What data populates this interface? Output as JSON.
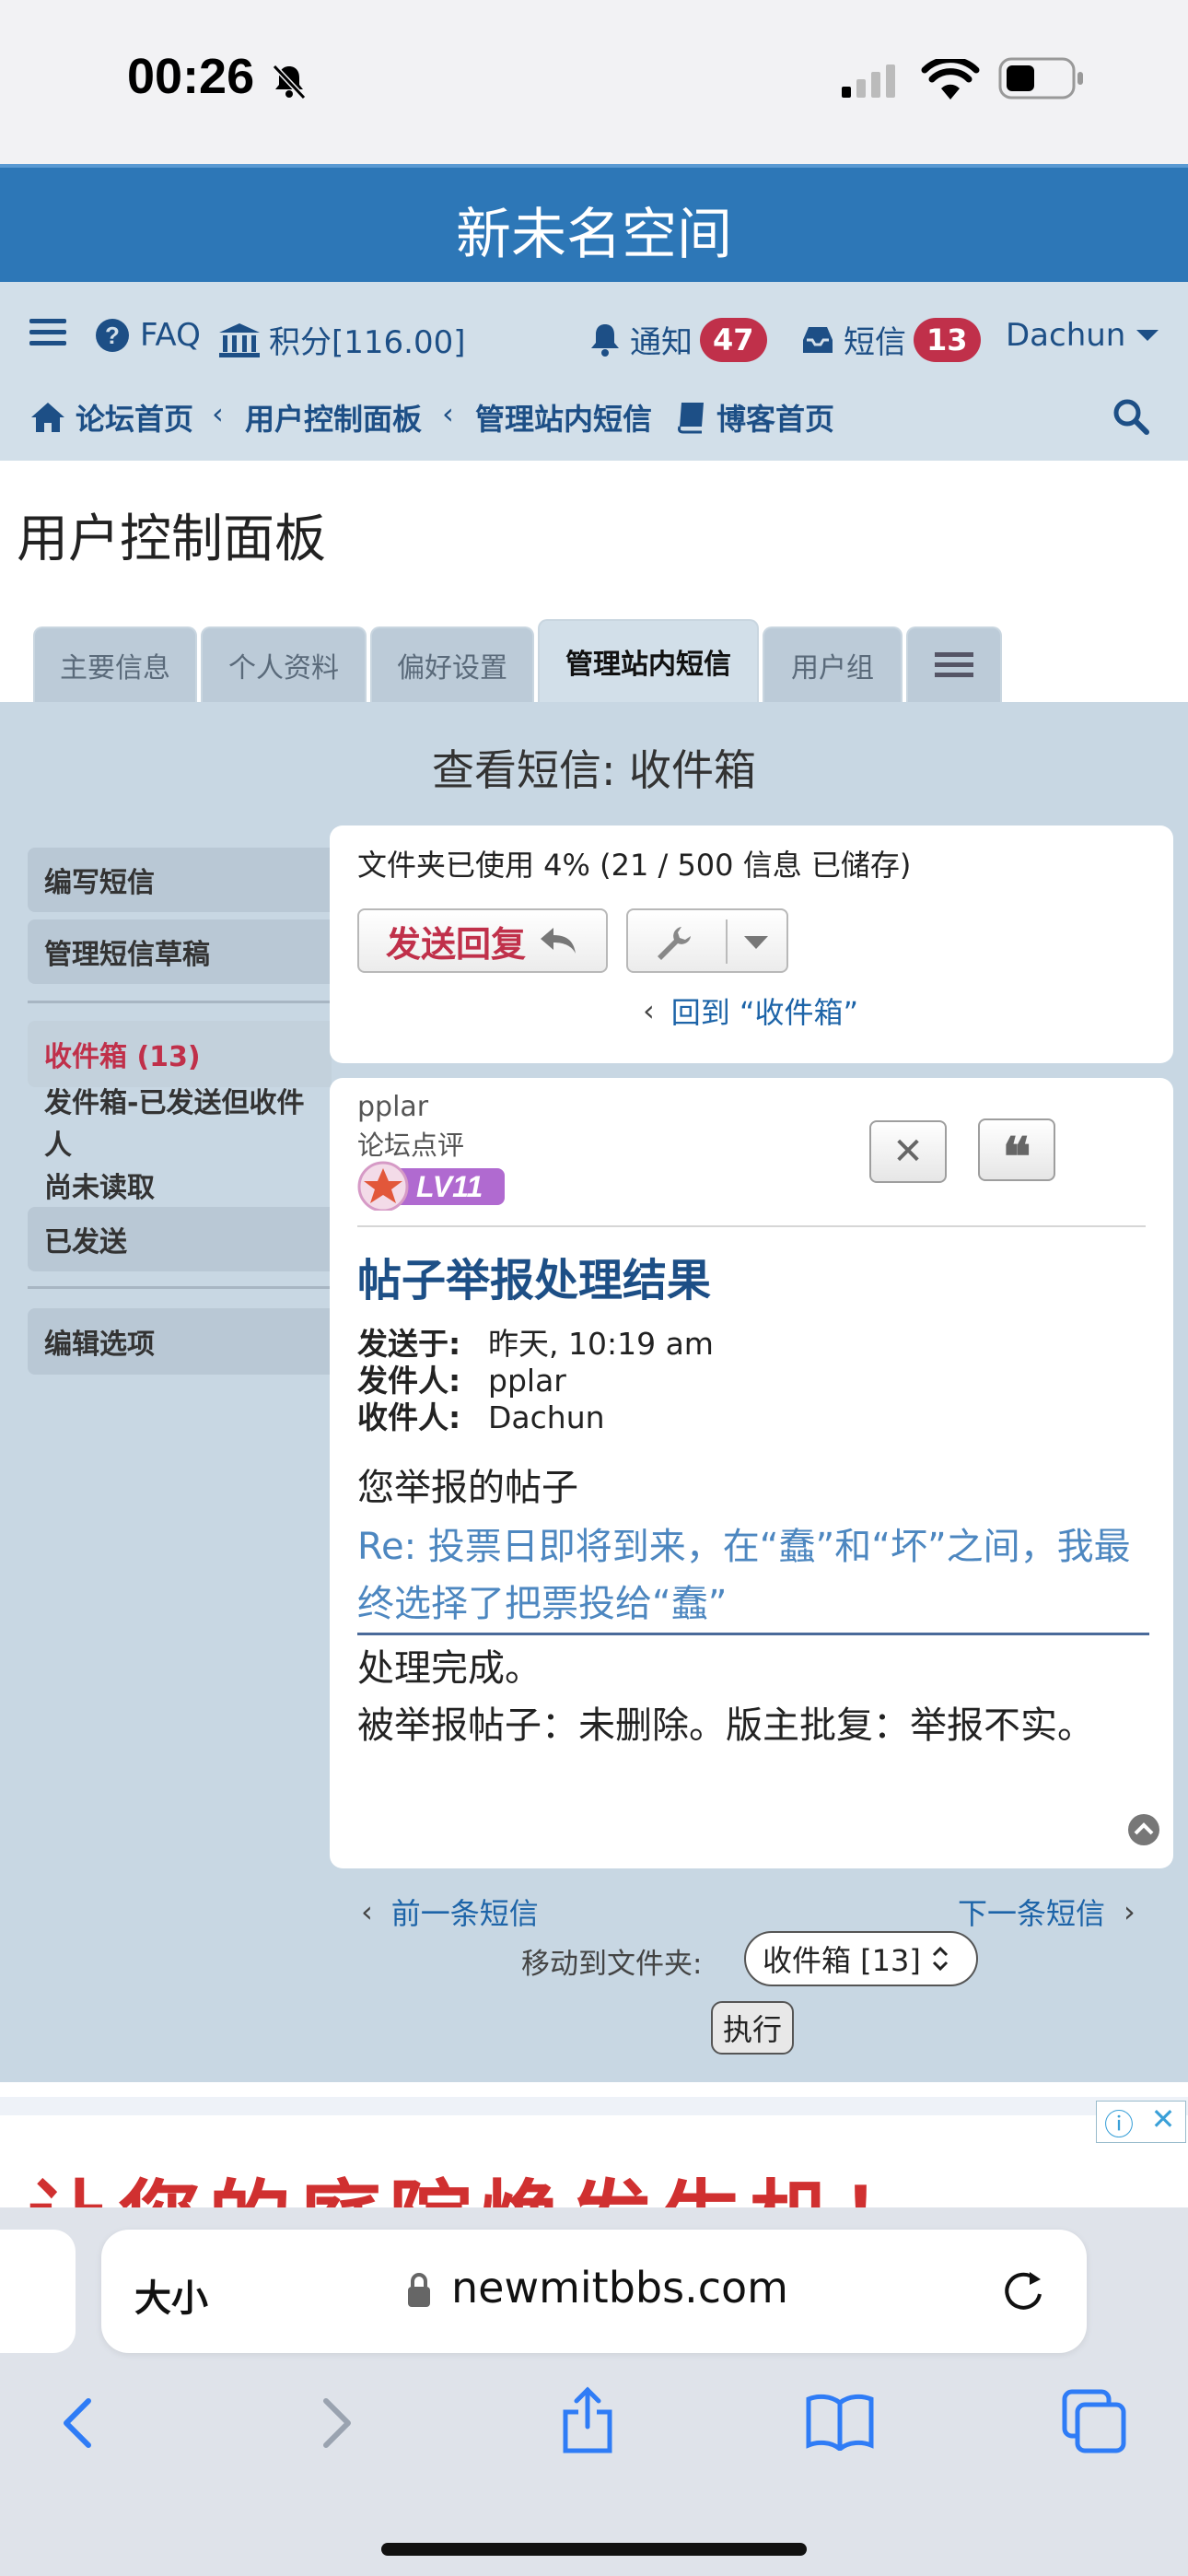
{
  "status_bar": {
    "time": "00:26"
  },
  "header": {
    "title": "新未名空间"
  },
  "navbar": {
    "faq": "FAQ",
    "points": "积分[116.00]",
    "notifications_label": "通知",
    "notifications_count": "47",
    "messages_label": "短信",
    "messages_count": "13",
    "username": "Dachun",
    "breadcrumbs": [
      "论坛首页",
      "用户控制面板",
      "管理站内短信",
      "博客首页"
    ]
  },
  "page_title": "用户控制面板",
  "tabs": [
    "主要信息",
    "个人资料",
    "偏好设置",
    "管理站内短信",
    "用户组"
  ],
  "section_title": "查看短信:  收件箱",
  "left_menu": {
    "compose": "编写短信",
    "drafts": "管理短信草稿",
    "inbox": "收件箱 (13)",
    "outbox": [
      "发件箱-已发送但收件人",
      "尚未读取"
    ],
    "sent": "已发送",
    "options": "编辑选项"
  },
  "folder_panel": {
    "usage": "文件夹已使用 4% (21 / 500 信息 已储存)",
    "reply_button": "发送回复",
    "back_link": "回到 “收件箱”"
  },
  "message": {
    "author": "pplar",
    "author_rank": "论坛点评",
    "level_badge": "LV11",
    "subject": "帖子举报处理结果",
    "sent_label": "发送于:",
    "sent_value": "昨天, 10:19 am",
    "from_label": "发件人:",
    "from_value": "pplar",
    "to_label": "收件人:",
    "to_value": "Dachun",
    "body_intro": "您举报的帖子",
    "body_link": "Re: 投票日即将到来，在“蠢”和“坏”之间，我最终选择了把票投给“蠢”",
    "body_done": "处理完成。",
    "body_result": "被举报帖子：未删除。版主批复：举报不实。"
  },
  "pager": {
    "prev": "前一条短信",
    "next": "下一条短信",
    "move_label": "移动到文件夹:",
    "folder_select": "收件箱 [13]",
    "execute": "执行"
  },
  "ad": {
    "text": "让您的庭院焕发生机！"
  },
  "safari": {
    "text_size": "大小",
    "url": "newmitbbs.com"
  },
  "colors": {
    "header_blue": "#2d77b7",
    "accent_red": "#c0304a",
    "link_blue": "#1d64a8"
  }
}
